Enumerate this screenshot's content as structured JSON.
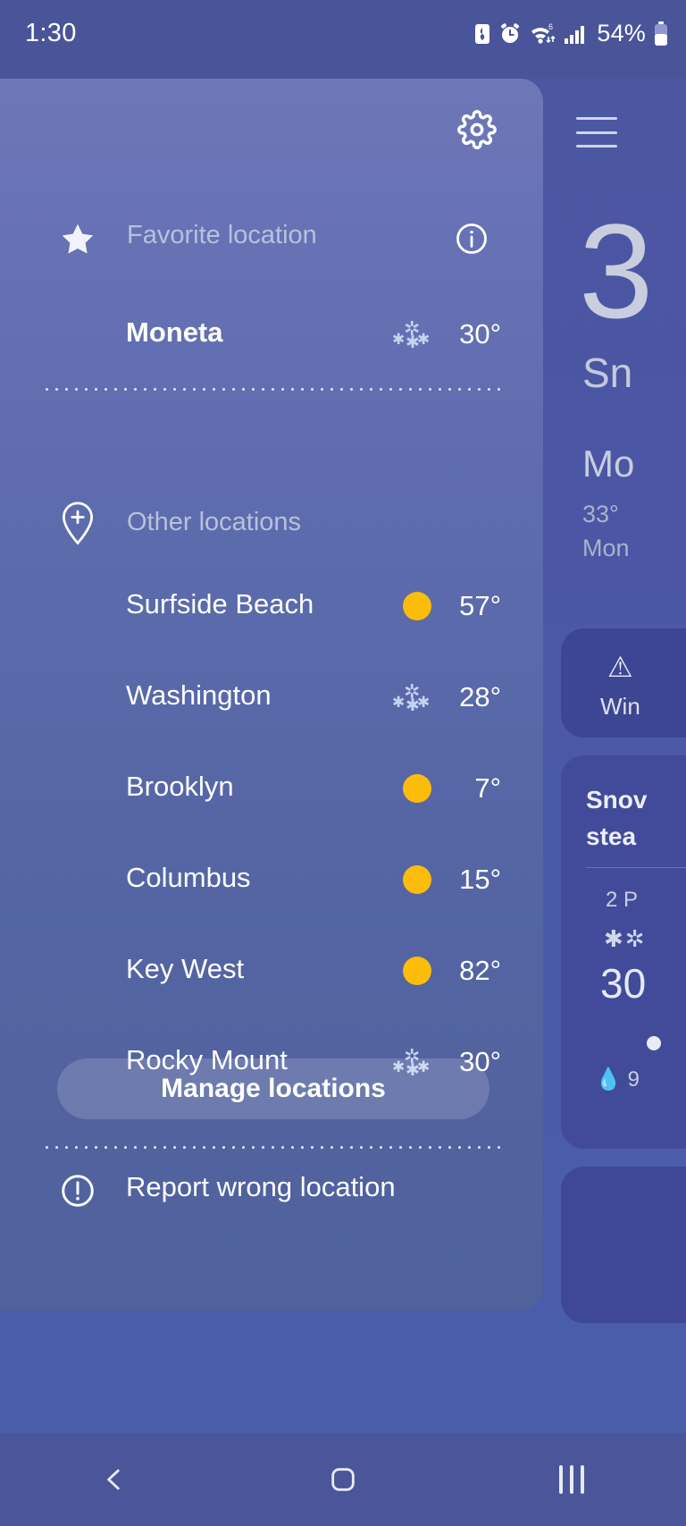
{
  "status_bar": {
    "time": "1:30",
    "battery_percent": "54%",
    "icons": [
      "battery-saver-icon",
      "alarm-icon",
      "wifi-6-icon",
      "signal-bars-icon",
      "battery-icon"
    ]
  },
  "drawer": {
    "settings_icon": "gear-icon",
    "favorite_section": {
      "icon": "star-icon",
      "label": "Favorite location",
      "info_icon": "info-icon",
      "location": {
        "name": "Moneta",
        "temperature": "30°",
        "condition_icon": "snow-icon"
      }
    },
    "other_section": {
      "icon": "add-location-pin-icon",
      "label": "Other locations",
      "locations": [
        {
          "name": "Surfside Beach",
          "temperature": "57°",
          "condition_icon": "sunny-icon"
        },
        {
          "name": "Washington",
          "temperature": "28°",
          "condition_icon": "snow-icon"
        },
        {
          "name": "Brooklyn",
          "temperature": "7°",
          "condition_icon": "sunny-icon"
        },
        {
          "name": "Columbus",
          "temperature": "15°",
          "condition_icon": "sunny-icon"
        },
        {
          "name": "Key West",
          "temperature": "82°",
          "condition_icon": "sunny-icon"
        },
        {
          "name": "Rocky Mount",
          "temperature": "30°",
          "condition_icon": "snow-icon"
        }
      ]
    },
    "manage_button_label": "Manage locations",
    "report_row": {
      "icon": "exclamation-circle-icon",
      "label": "Report wrong location"
    }
  },
  "background_screen": {
    "menu_icon": "hamburger-menu-icon",
    "big_temperature": "3",
    "condition": "Sn",
    "city": "Mo",
    "high_low": "33°",
    "day": "Mon",
    "alert_card": {
      "icon": "warning-triangle-icon",
      "text": "Win"
    },
    "snow_card": {
      "title_line1": "Snov",
      "title_line2": "stea",
      "hour": "2 P",
      "flake_icon": "snow-icon",
      "temperature": "30",
      "precip": "9"
    }
  },
  "nav_bar": {
    "back_icon": "back-chevron-icon",
    "home_icon": "home-square-icon",
    "recents_icon": "recents-bars-icon"
  },
  "colors": {
    "sun_yellow": "#FBBC0A",
    "drawer_top": "#6E77B8",
    "drawer_bottom": "#50619C",
    "status_bar": "#4A5499",
    "nav_bar": "#4B5599"
  }
}
